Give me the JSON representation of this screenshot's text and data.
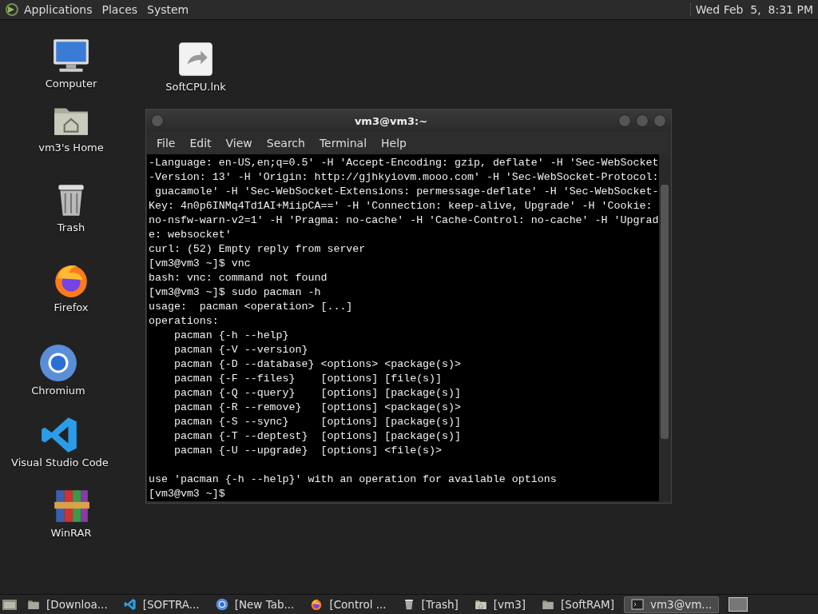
{
  "top_panel": {
    "menus": [
      "Applications",
      "Places",
      "System"
    ],
    "clock": "Wed Feb  5,  8:31 PM"
  },
  "desktop_icons": [
    {
      "label": "Computer",
      "kind": "computer"
    },
    {
      "label": "vm3's Home",
      "kind": "home"
    },
    {
      "label": "Trash",
      "kind": "trash"
    },
    {
      "label": "Firefox",
      "kind": "firefox"
    },
    {
      "label": "Chromium",
      "kind": "chromium"
    },
    {
      "label": "Visual Studio Code",
      "kind": "vscode"
    },
    {
      "label": "WinRAR",
      "kind": "winrar"
    },
    {
      "label": "SoftCPU.lnk",
      "kind": "shortcut"
    }
  ],
  "terminal": {
    "title": "vm3@vm3:~",
    "menus": [
      "File",
      "Edit",
      "View",
      "Search",
      "Terminal",
      "Help"
    ],
    "lines": [
      {
        "text": "-Language: en-US,en;q=0.5' -H 'Accept-Encoding: gzip, deflate' -H 'Sec-WebSocket"
      },
      {
        "text": "-Version: 13' -H 'Origin: http://gjhkyiovm.mooo.com' -H 'Sec-WebSocket-Protocol:"
      },
      {
        "text": " guacamole' -H 'Sec-WebSocket-Extensions: permessage-deflate' -H 'Sec-WebSocket-"
      },
      {
        "text": "Key: 4n0p6INMq4Td1AI+MiipCA==' -H 'Connection: keep-alive, Upgrade' -H 'Cookie:"
      },
      {
        "text": "no-nsfw-warn-v2=1' -H 'Pragma: no-cache' -H 'Cache-Control: no-cache' -H 'Upgrad"
      },
      {
        "text": "e: websocket'"
      },
      {
        "text": "curl: (52) Empty reply from server"
      },
      {
        "text": "[vm3@vm3 ~]$ vnc"
      },
      {
        "text": "bash: vnc: command not found"
      },
      {
        "text": "[vm3@vm3 ~]$ sudo pacman -h"
      },
      {
        "text": "usage:  pacman <operation> [...]"
      },
      {
        "text": "operations:"
      },
      {
        "text": "    pacman {-h --help}"
      },
      {
        "text": "    pacman {-V --version}"
      },
      {
        "text": "    pacman {-D --database} <options> <package(s)>"
      },
      {
        "text": "    pacman {-F --files}    [options] [file(s)]"
      },
      {
        "text": "    pacman {-Q --query}    [options] [package(s)]"
      },
      {
        "text": "    pacman {-R --remove}   [options] <package(s)>"
      },
      {
        "text": "    pacman {-S --sync}     [options] [package(s)]"
      },
      {
        "text": "    pacman {-T --deptest}  [options] [package(s)]"
      },
      {
        "text": "    pacman {-U --upgrade}  [options] <file(s)>"
      },
      {
        "text": "use 'pacman {-h --help}' with an operation for available options",
        "blank_before": true
      },
      {
        "text": "[vm3@vm3 ~]$"
      }
    ]
  },
  "taskbar": {
    "items": [
      {
        "label": "[Downloa...",
        "kind": "folder",
        "selected": false
      },
      {
        "label": "[SOFTRA...",
        "kind": "vscode",
        "selected": false
      },
      {
        "label": "[New Tab...",
        "kind": "chromium",
        "selected": false
      },
      {
        "label": "[Control ...",
        "kind": "firefox",
        "selected": false
      },
      {
        "label": "[Trash]",
        "kind": "trash",
        "selected": false
      },
      {
        "label": "[vm3]",
        "kind": "home",
        "selected": false
      },
      {
        "label": "[SoftRAM]",
        "kind": "folder",
        "selected": false
      },
      {
        "label": "vm3@vm...",
        "kind": "terminal",
        "selected": true
      }
    ]
  }
}
